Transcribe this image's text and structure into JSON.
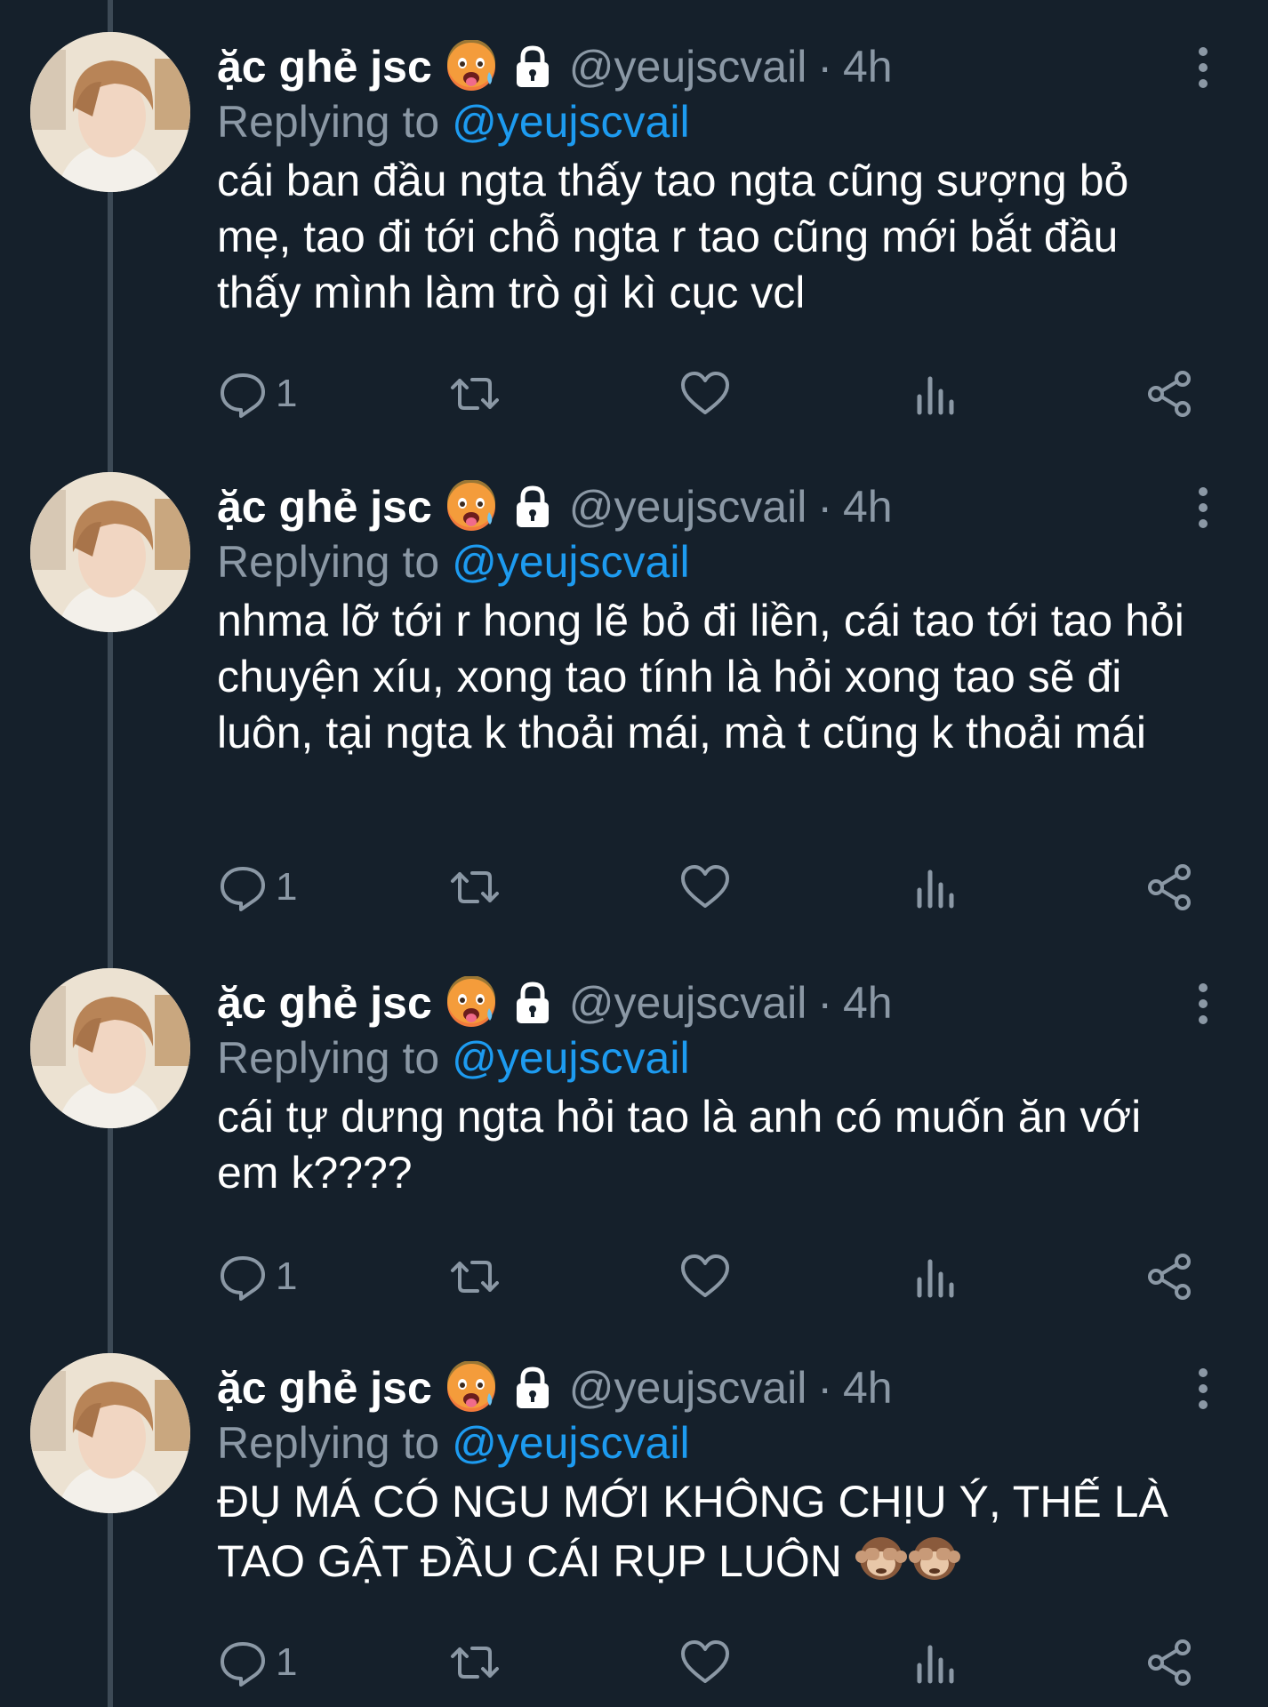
{
  "tweets": [
    {
      "name": "ặc ghẻ jsc",
      "handle": "@yeujscvail",
      "separator": "·",
      "time": "4h",
      "replying_prefix": "Replying to",
      "replying_to": "@yeujscvail",
      "text": "cái ban đầu ngta thấy tao ngta cũng sượng bỏ mẹ, tao đi tới chỗ ngta r tao cũng mới bắt đầu thấy mình làm trò gì kì cục vcl",
      "reply_count": "1"
    },
    {
      "name": "ặc ghẻ jsc",
      "handle": "@yeujscvail",
      "separator": "·",
      "time": "4h",
      "replying_prefix": "Replying to",
      "replying_to": "@yeujscvail",
      "text": "nhma lỡ tới r hong lẽ bỏ đi liền, cái tao tới tao hỏi chuyện xíu, xong tao tính là hỏi xong tao sẽ đi luôn, tại ngta k thoải mái, mà t cũng k thoải mái",
      "reply_count": "1"
    },
    {
      "name": "ặc ghẻ jsc",
      "handle": "@yeujscvail",
      "separator": "·",
      "time": "4h",
      "replying_prefix": "Replying to",
      "replying_to": "@yeujscvail",
      "text": "cái tự dưng ngta hỏi tao là anh có muốn ăn với em k????",
      "reply_count": "1"
    },
    {
      "name": "ặc ghẻ jsc",
      "handle": "@yeujscvail",
      "separator": "·",
      "time": "4h",
      "replying_prefix": "Replying to",
      "replying_to": "@yeujscvail",
      "text": "ĐỤ MÁ CÓ NGU MỚI KHÔNG CHỊU Ý, THẾ LÀ TAO GẬT ĐẦU CÁI RỤP LUÔN",
      "reply_count": "1"
    }
  ],
  "icons": {
    "badge_emoji": "hot-face-emoji-icon",
    "protected": "lock-icon",
    "more": "more-vertical-icon",
    "reply": "reply-icon",
    "retweet": "retweet-icon",
    "like": "like-icon",
    "views": "views-icon",
    "share": "share-icon",
    "text_emoji": "see-no-evil-monkey-emoji-icon"
  },
  "colors": {
    "background": "#15202b",
    "secondary_text": "#8b98a5",
    "mention": "#1d9bf0",
    "thread_line": "#3d4a56"
  }
}
